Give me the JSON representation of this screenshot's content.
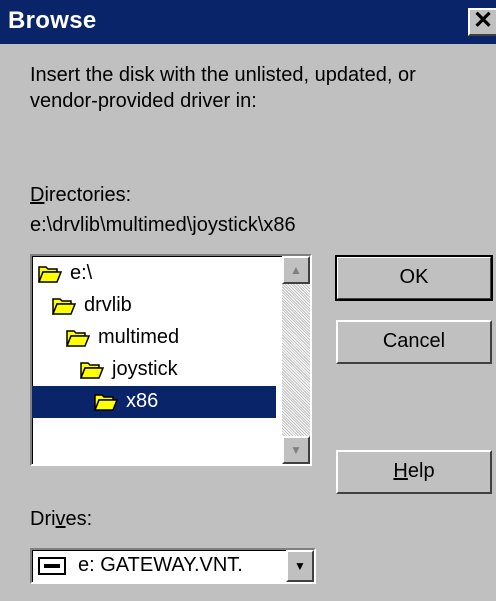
{
  "window": {
    "title": "Browse",
    "close_glyph": "✕"
  },
  "instruction": {
    "line1": "Insert the disk with the unlisted, updated, or",
    "line2": "vendor-provided driver in:"
  },
  "directories": {
    "label_mnemonic": "D",
    "label_rest": "irectories:",
    "current_path": "e:\\drvlib\\multimed\\joystick\\x86",
    "items": [
      {
        "label": "e:\\",
        "state": "open"
      },
      {
        "label": "drvlib",
        "state": "open"
      },
      {
        "label": "multimed",
        "state": "open"
      },
      {
        "label": "joystick",
        "state": "open"
      },
      {
        "label": "x86",
        "state": "open",
        "selected": true
      }
    ]
  },
  "buttons": {
    "ok": "OK",
    "cancel": "Cancel",
    "help_mnemonic": "H",
    "help_rest": "elp"
  },
  "drives": {
    "label_pre": "Dri",
    "label_mnemonic": "v",
    "label_post": "es:",
    "selected": "e: GATEWAY.VNT."
  },
  "colors": {
    "dialog_bg": "#c0c0c0",
    "titlebar": "#0a246a",
    "selection": "#0a246a",
    "folder": "#ffff00"
  },
  "icons": {
    "folder": "folder-open-icon",
    "drive": "network-drive-icon",
    "up": "scroll-up-arrow-icon",
    "down": "scroll-down-arrow-icon",
    "dropdown": "dropdown-arrow-icon"
  }
}
